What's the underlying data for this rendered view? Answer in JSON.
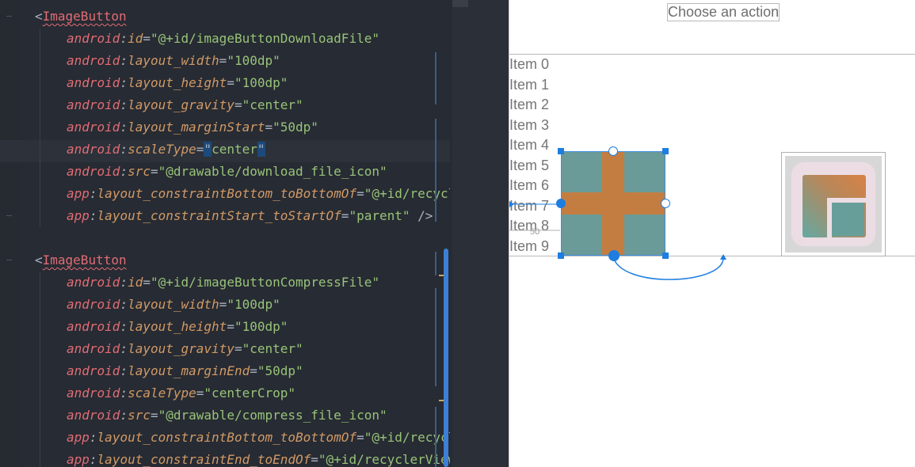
{
  "editor": {
    "lines": [
      {
        "parts": [
          [
            "punct",
            "<"
          ],
          [
            "tag",
            "ImageButton"
          ]
        ]
      },
      {
        "parts": [
          [
            "ns",
            "android"
          ],
          [
            "colon",
            ":"
          ],
          [
            "attr",
            "id"
          ],
          [
            "punct",
            "="
          ],
          [
            "str",
            "\"@+id/imageButtonDownloadFile\""
          ]
        ]
      },
      {
        "parts": [
          [
            "ns",
            "android"
          ],
          [
            "colon",
            ":"
          ],
          [
            "attr",
            "layout_width"
          ],
          [
            "punct",
            "="
          ],
          [
            "str",
            "\"100dp\""
          ]
        ]
      },
      {
        "parts": [
          [
            "ns",
            "android"
          ],
          [
            "colon",
            ":"
          ],
          [
            "attr",
            "layout_height"
          ],
          [
            "punct",
            "="
          ],
          [
            "str",
            "\"100dp\""
          ]
        ]
      },
      {
        "parts": [
          [
            "ns",
            "android"
          ],
          [
            "colon",
            ":"
          ],
          [
            "attr",
            "layout_gravity"
          ],
          [
            "punct",
            "="
          ],
          [
            "str",
            "\"center\""
          ]
        ]
      },
      {
        "parts": [
          [
            "ns",
            "android"
          ],
          [
            "colon",
            ":"
          ],
          [
            "attr",
            "layout_marginStart"
          ],
          [
            "punct",
            "="
          ],
          [
            "str",
            "\"50dp\""
          ]
        ]
      },
      {
        "parts": [
          [
            "ns",
            "android"
          ],
          [
            "colon",
            ":"
          ],
          [
            "attr",
            "scaleType"
          ],
          [
            "punct",
            "="
          ],
          [
            "hl",
            "\""
          ],
          [
            "str",
            "center"
          ],
          [
            "hl",
            "\""
          ]
        ]
      },
      {
        "parts": [
          [
            "ns",
            "android"
          ],
          [
            "colon",
            ":"
          ],
          [
            "attr",
            "src"
          ],
          [
            "punct",
            "="
          ],
          [
            "str",
            "\"@drawable/download_file_icon\""
          ]
        ]
      },
      {
        "parts": [
          [
            "ns",
            "app"
          ],
          [
            "colon",
            ":"
          ],
          [
            "attr",
            "layout_constraintBottom_toBottomOf"
          ],
          [
            "punct",
            "="
          ],
          [
            "str",
            "\"@+id/recyclerView\""
          ]
        ]
      },
      {
        "parts": [
          [
            "ns",
            "app"
          ],
          [
            "colon",
            ":"
          ],
          [
            "attr",
            "layout_constraintStart_toStartOf"
          ],
          [
            "punct",
            "="
          ],
          [
            "str",
            "\"parent\""
          ],
          [
            "punct",
            " />"
          ]
        ]
      },
      {
        "parts": []
      },
      {
        "parts": [
          [
            "punct",
            "<"
          ],
          [
            "tag",
            "ImageButton"
          ]
        ]
      },
      {
        "parts": [
          [
            "ns",
            "android"
          ],
          [
            "colon",
            ":"
          ],
          [
            "attr",
            "id"
          ],
          [
            "punct",
            "="
          ],
          [
            "str",
            "\"@+id/imageButtonCompressFile\""
          ]
        ]
      },
      {
        "parts": [
          [
            "ns",
            "android"
          ],
          [
            "colon",
            ":"
          ],
          [
            "attr",
            "layout_width"
          ],
          [
            "punct",
            "="
          ],
          [
            "str",
            "\"100dp\""
          ]
        ]
      },
      {
        "parts": [
          [
            "ns",
            "android"
          ],
          [
            "colon",
            ":"
          ],
          [
            "attr",
            "layout_height"
          ],
          [
            "punct",
            "="
          ],
          [
            "str",
            "\"100dp\""
          ]
        ]
      },
      {
        "parts": [
          [
            "ns",
            "android"
          ],
          [
            "colon",
            ":"
          ],
          [
            "attr",
            "layout_gravity"
          ],
          [
            "punct",
            "="
          ],
          [
            "str",
            "\"center\""
          ]
        ]
      },
      {
        "parts": [
          [
            "ns",
            "android"
          ],
          [
            "colon",
            ":"
          ],
          [
            "attr",
            "layout_marginEnd"
          ],
          [
            "punct",
            "="
          ],
          [
            "str",
            "\"50dp\""
          ]
        ]
      },
      {
        "parts": [
          [
            "ns",
            "android"
          ],
          [
            "colon",
            ":"
          ],
          [
            "attr",
            "scaleType"
          ],
          [
            "punct",
            "="
          ],
          [
            "str",
            "\"centerCrop\""
          ]
        ]
      },
      {
        "parts": [
          [
            "ns",
            "android"
          ],
          [
            "colon",
            ":"
          ],
          [
            "attr",
            "src"
          ],
          [
            "punct",
            "="
          ],
          [
            "str",
            "\"@drawable/compress_file_icon\""
          ]
        ]
      },
      {
        "parts": [
          [
            "ns",
            "app"
          ],
          [
            "colon",
            ":"
          ],
          [
            "attr",
            "layout_constraintBottom_toBottomOf"
          ],
          [
            "punct",
            "="
          ],
          [
            "str",
            "\"@+id/recyclerView\""
          ]
        ]
      },
      {
        "parts": [
          [
            "ns",
            "app"
          ],
          [
            "colon",
            ":"
          ],
          [
            "attr",
            "layout_constraintEnd_toEndOf"
          ],
          [
            "punct",
            "="
          ],
          [
            "str",
            "\"@+id/recyclerView\""
          ]
        ]
      }
    ]
  },
  "design": {
    "spinner_text": "Choose an action",
    "items": [
      "Item 0",
      "Item 1",
      "Item 2",
      "Item 3",
      "Item 4",
      "Item 5",
      "Item 6",
      "Item 7",
      "Item 8",
      "Item 9"
    ],
    "margin_label": "50",
    "accent": "#1e7de0"
  }
}
